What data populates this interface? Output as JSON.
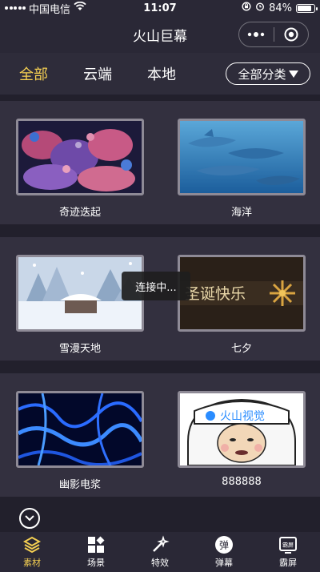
{
  "status_bar": {
    "carrier": "中国电信",
    "time": "11:07",
    "battery": "84%",
    "battery_level": 0.84
  },
  "nav": {
    "title": "火山巨幕"
  },
  "tabs": {
    "items": [
      {
        "label": "全部",
        "active": true
      },
      {
        "label": "云端",
        "active": false
      },
      {
        "label": "本地",
        "active": false
      }
    ],
    "category_label": "全部分类"
  },
  "gallery": {
    "items": [
      {
        "caption": "奇迹迭起",
        "thumb": "coral-reef"
      },
      {
        "caption": "海洋",
        "thumb": "dolphins"
      },
      {
        "caption": "雪漫天地",
        "thumb": "snow-house"
      },
      {
        "caption": "七夕",
        "thumb": "merry-christmas",
        "overlay_text": "圣诞快乐"
      },
      {
        "caption": "幽影电浆",
        "thumb": "blue-plasma"
      },
      {
        "caption": "888888",
        "thumb": "cartoon-face",
        "overlay_text": "火山视觉"
      }
    ]
  },
  "toast": {
    "text": "连接中..."
  },
  "bottom_bar": {
    "items": [
      {
        "label": "素材",
        "icon": "layers-icon",
        "active": true
      },
      {
        "label": "场景",
        "icon": "scene-icon",
        "active": false
      },
      {
        "label": "特效",
        "icon": "magic-wand-icon",
        "active": false
      },
      {
        "label": "弹幕",
        "icon": "danmaku-icon",
        "icon_text": "弹",
        "active": false
      },
      {
        "label": "霸屏",
        "icon": "bapping-icon",
        "icon_text": "霸屏",
        "active": false
      }
    ]
  },
  "colors": {
    "accent": "#f4cf52",
    "background": "#22202c",
    "section": "#33303f"
  }
}
